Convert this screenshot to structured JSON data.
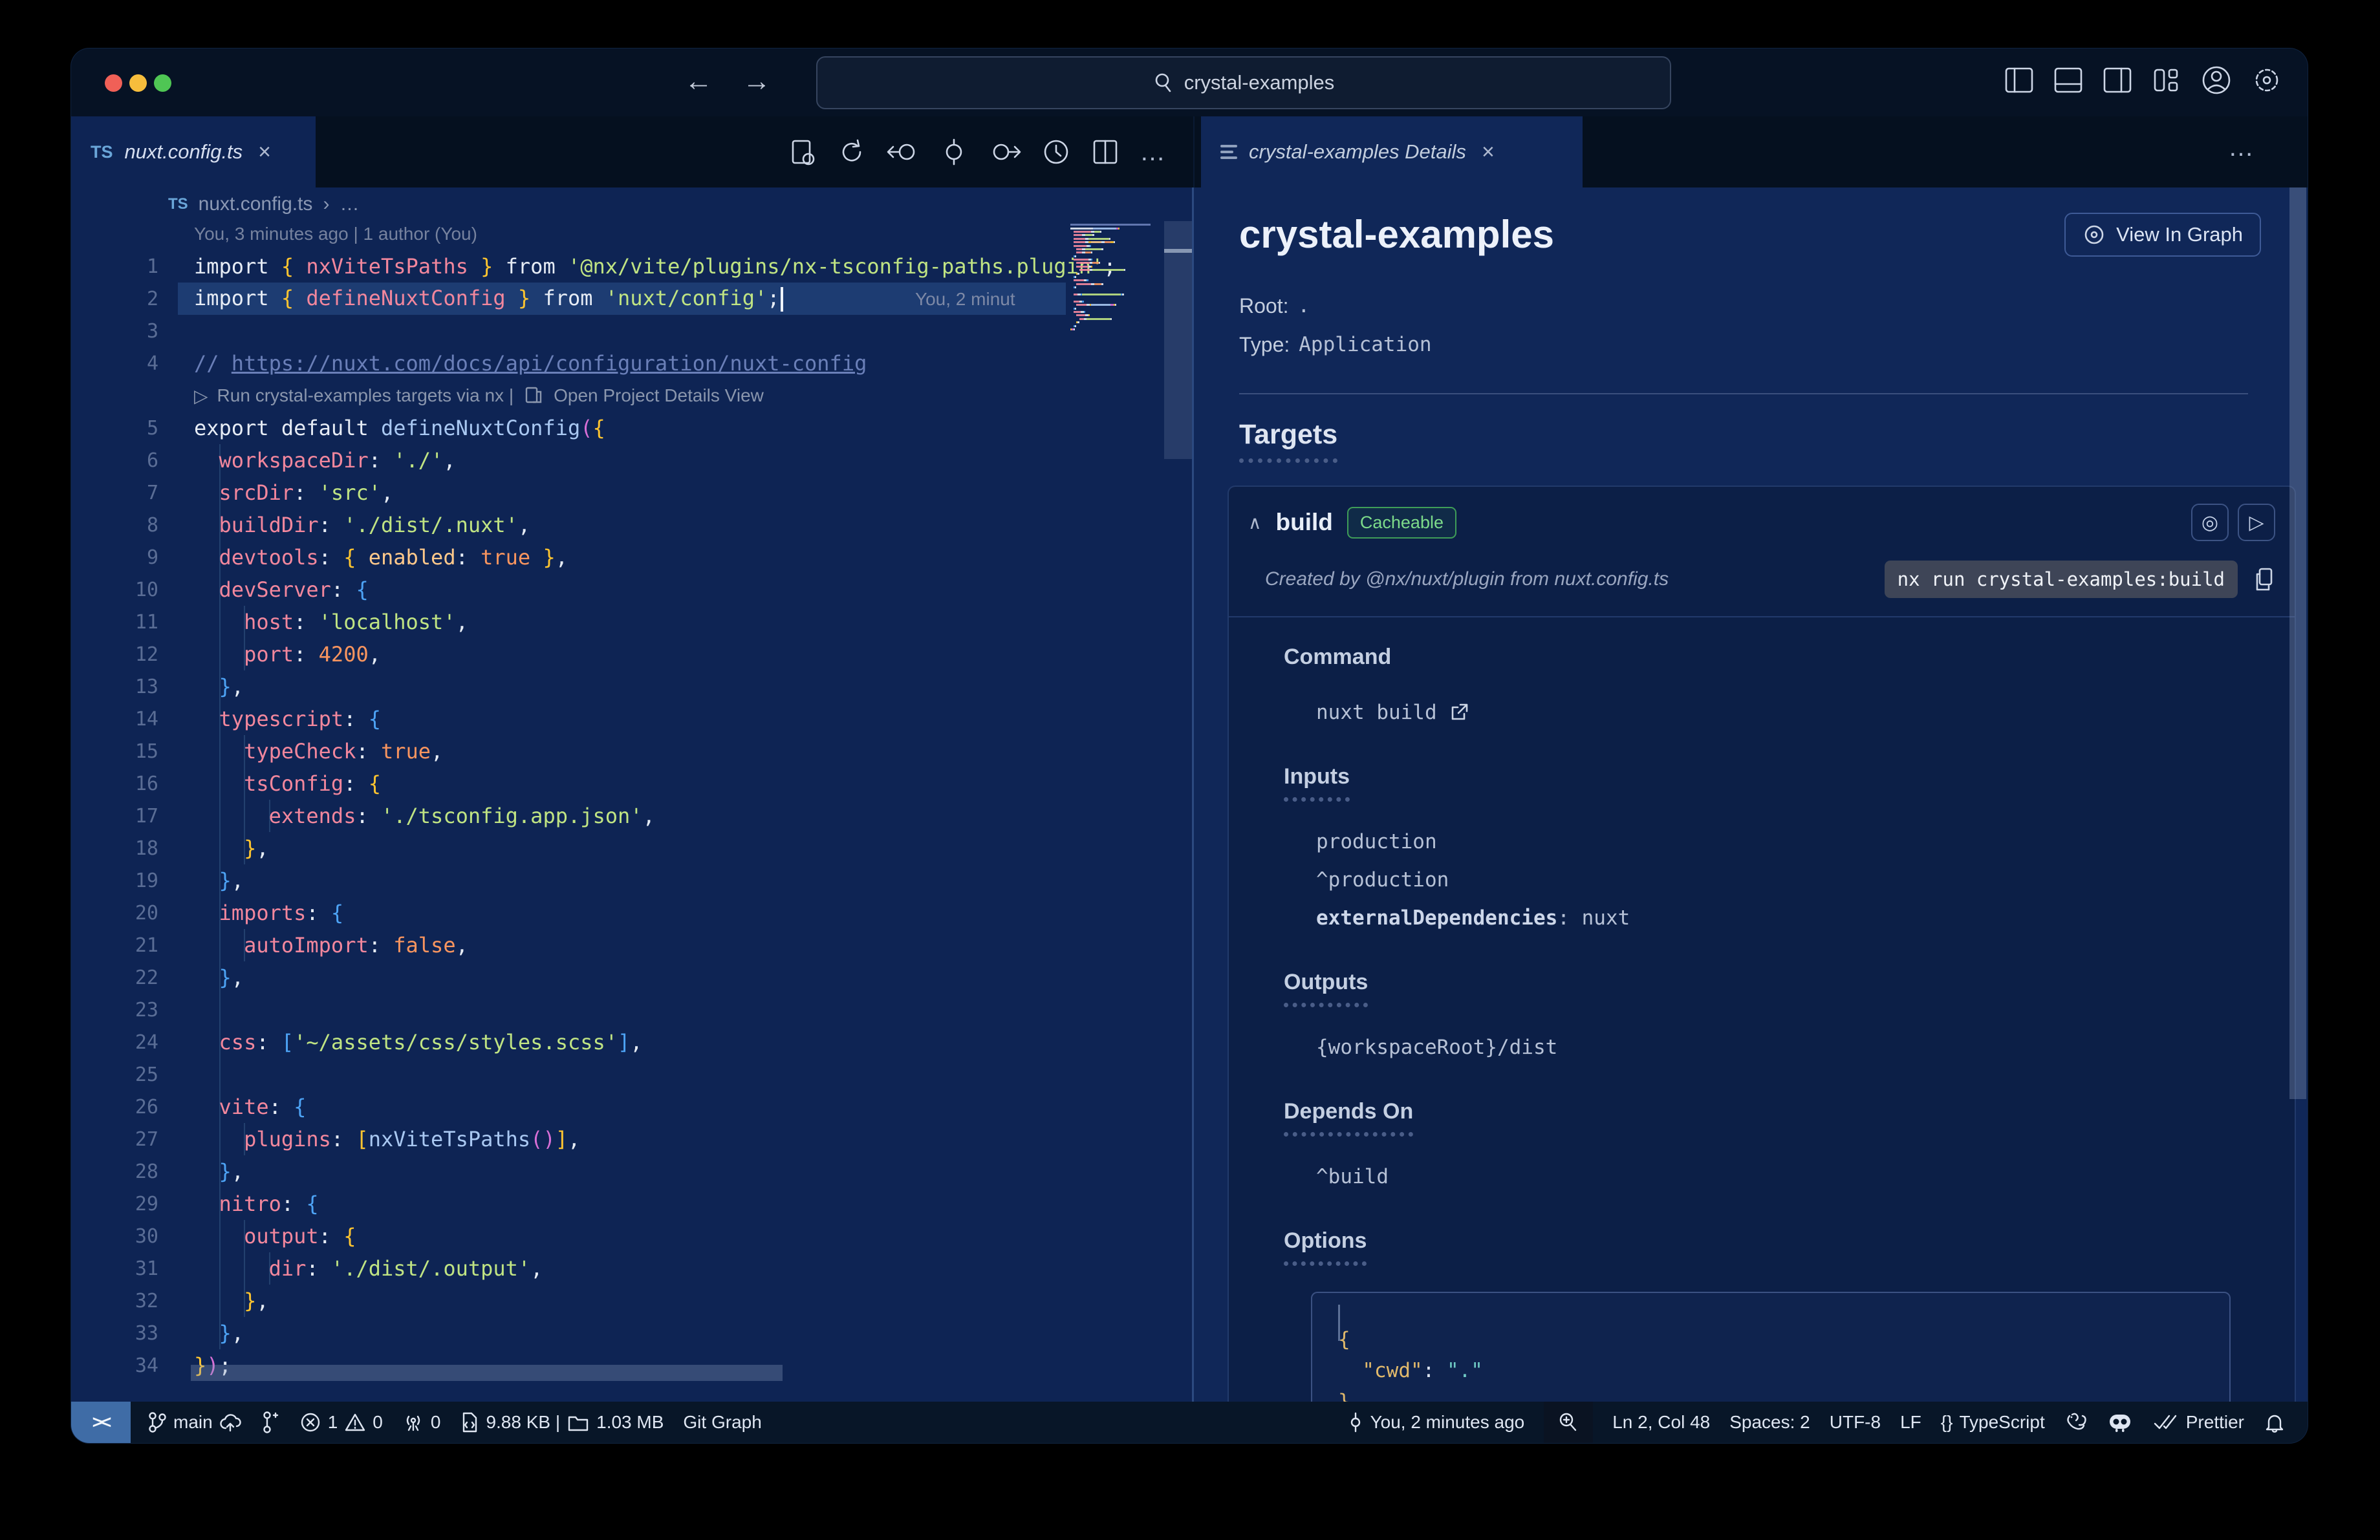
{
  "titlebar": {
    "search": "crystal-examples",
    "back": "←",
    "forward": "→"
  },
  "tabs": {
    "file": {
      "ts": "TS",
      "label": "nuxt.config.ts",
      "close": "×"
    },
    "details": {
      "label": "crystal-examples Details",
      "close": "×"
    },
    "more": "…"
  },
  "breadcrumb": {
    "ts": "TS",
    "file": "nuxt.config.ts",
    "sep": "›",
    "more": "…"
  },
  "editor": {
    "blame": "You, 3 minutes ago | 1 author (You)",
    "codelens": {
      "play": "▷",
      "run": "Run crystal-examples targets via nx  |",
      "open": "Open Project Details View"
    },
    "ghost": "You, 2 minut",
    "lines": [
      {
        "n": 1,
        "t": [
          [
            "import ",
            "pln"
          ],
          [
            "{ ",
            "bgold"
          ],
          [
            "nxViteTsPaths",
            "prop"
          ],
          [
            " }",
            "bgold"
          ],
          [
            " from ",
            "pln"
          ],
          [
            "'@nx/vite/plugins/nx-tsconfig-paths.plugin'",
            "str"
          ],
          [
            ";",
            "pln"
          ]
        ]
      },
      {
        "n": 2,
        "cur": true,
        "caret": true,
        "t": [
          [
            "import ",
            "pln"
          ],
          [
            "{ ",
            "bgold"
          ],
          [
            "defineNuxtConfig",
            "prop"
          ],
          [
            " }",
            "bgold"
          ],
          [
            " from ",
            "pln"
          ],
          [
            "'nuxt/config'",
            "str"
          ],
          [
            ";",
            "pln"
          ]
        ]
      },
      {
        "n": 3,
        "t": []
      },
      {
        "n": 4,
        "t": [
          [
            "// ",
            "cmt"
          ],
          [
            "https://nuxt.com/docs/api/configuration/nuxt-config",
            "lnk"
          ]
        ]
      },
      {
        "lens": true
      },
      {
        "n": 5,
        "t": [
          [
            "export default ",
            "pln"
          ],
          [
            "defineNuxtConfig",
            "call"
          ],
          [
            "(",
            "bmag"
          ],
          [
            "{",
            "bgold"
          ]
        ]
      },
      {
        "n": 6,
        "t": [
          [
            "  ",
            "pln"
          ],
          [
            "workspaceDir",
            "prop"
          ],
          [
            ": ",
            "pln"
          ],
          [
            "'./'",
            "str"
          ],
          [
            ",",
            "pln"
          ]
        ]
      },
      {
        "n": 7,
        "t": [
          [
            "  ",
            "pln"
          ],
          [
            "srcDir",
            "prop"
          ],
          [
            ": ",
            "pln"
          ],
          [
            "'src'",
            "str"
          ],
          [
            ",",
            "pln"
          ]
        ]
      },
      {
        "n": 8,
        "t": [
          [
            "  ",
            "pln"
          ],
          [
            "buildDir",
            "prop"
          ],
          [
            ": ",
            "pln"
          ],
          [
            "'./dist/.nuxt'",
            "str"
          ],
          [
            ",",
            "pln"
          ]
        ]
      },
      {
        "n": 9,
        "t": [
          [
            "  ",
            "pln"
          ],
          [
            "devtools",
            "prop"
          ],
          [
            ": ",
            "pln"
          ],
          [
            "{ ",
            "bgold"
          ],
          [
            "enabled",
            "peach"
          ],
          [
            ": ",
            "pln"
          ],
          [
            "true",
            "num"
          ],
          [
            " }",
            "bgold"
          ],
          [
            ",",
            "pln"
          ]
        ]
      },
      {
        "n": 10,
        "t": [
          [
            "  ",
            "pln"
          ],
          [
            "devServer",
            "prop"
          ],
          [
            ": ",
            "pln"
          ],
          [
            "{",
            "bblue"
          ]
        ]
      },
      {
        "n": 11,
        "t": [
          [
            "    ",
            "pln"
          ],
          [
            "host",
            "prop"
          ],
          [
            ": ",
            "pln"
          ],
          [
            "'localhost'",
            "str"
          ],
          [
            ",",
            "pln"
          ]
        ]
      },
      {
        "n": 12,
        "t": [
          [
            "    ",
            "pln"
          ],
          [
            "port",
            "prop"
          ],
          [
            ": ",
            "pln"
          ],
          [
            "4200",
            "num"
          ],
          [
            ",",
            "pln"
          ]
        ]
      },
      {
        "n": 13,
        "t": [
          [
            "  ",
            "pln"
          ],
          [
            "}",
            "bblue"
          ],
          [
            ",",
            "pln"
          ]
        ]
      },
      {
        "n": 14,
        "t": [
          [
            "  ",
            "pln"
          ],
          [
            "typescript",
            "prop"
          ],
          [
            ": ",
            "pln"
          ],
          [
            "{",
            "bblue"
          ]
        ]
      },
      {
        "n": 15,
        "t": [
          [
            "    ",
            "pln"
          ],
          [
            "typeCheck",
            "prop"
          ],
          [
            ": ",
            "pln"
          ],
          [
            "true",
            "num"
          ],
          [
            ",",
            "pln"
          ]
        ]
      },
      {
        "n": 16,
        "t": [
          [
            "    ",
            "pln"
          ],
          [
            "tsConfig",
            "prop"
          ],
          [
            ": ",
            "pln"
          ],
          [
            "{",
            "bgold"
          ]
        ]
      },
      {
        "n": 17,
        "t": [
          [
            "      ",
            "pln"
          ],
          [
            "extends",
            "prop"
          ],
          [
            ": ",
            "pln"
          ],
          [
            "'./tsconfig.app.json'",
            "str"
          ],
          [
            ",",
            "pln"
          ]
        ]
      },
      {
        "n": 18,
        "t": [
          [
            "    ",
            "pln"
          ],
          [
            "}",
            "bgold"
          ],
          [
            ",",
            "pln"
          ]
        ]
      },
      {
        "n": 19,
        "t": [
          [
            "  ",
            "pln"
          ],
          [
            "}",
            "bblue"
          ],
          [
            ",",
            "pln"
          ]
        ]
      },
      {
        "n": 20,
        "t": [
          [
            "  ",
            "pln"
          ],
          [
            "imports",
            "prop"
          ],
          [
            ": ",
            "pln"
          ],
          [
            "{",
            "bblue"
          ]
        ]
      },
      {
        "n": 21,
        "t": [
          [
            "    ",
            "pln"
          ],
          [
            "autoImport",
            "prop"
          ],
          [
            ": ",
            "pln"
          ],
          [
            "false",
            "num"
          ],
          [
            ",",
            "pln"
          ]
        ]
      },
      {
        "n": 22,
        "t": [
          [
            "  ",
            "pln"
          ],
          [
            "}",
            "bblue"
          ],
          [
            ",",
            "pln"
          ]
        ]
      },
      {
        "n": 23,
        "t": []
      },
      {
        "n": 24,
        "t": [
          [
            "  ",
            "pln"
          ],
          [
            "css",
            "prop"
          ],
          [
            ": ",
            "pln"
          ],
          [
            "[",
            "bblue"
          ],
          [
            "'~/assets/css/styles.scss'",
            "str"
          ],
          [
            "]",
            "bblue"
          ],
          [
            ",",
            "pln"
          ]
        ]
      },
      {
        "n": 25,
        "t": []
      },
      {
        "n": 26,
        "t": [
          [
            "  ",
            "pln"
          ],
          [
            "vite",
            "prop"
          ],
          [
            ": ",
            "pln"
          ],
          [
            "{",
            "bblue"
          ]
        ]
      },
      {
        "n": 27,
        "t": [
          [
            "    ",
            "pln"
          ],
          [
            "plugins",
            "prop"
          ],
          [
            ": ",
            "pln"
          ],
          [
            "[",
            "bgold"
          ],
          [
            "nxViteTsPaths",
            "call"
          ],
          [
            "(",
            "bmag"
          ],
          [
            ")",
            "bmag"
          ],
          [
            "]",
            "bgold"
          ],
          [
            ",",
            "pln"
          ]
        ]
      },
      {
        "n": 28,
        "t": [
          [
            "  ",
            "pln"
          ],
          [
            "}",
            "bblue"
          ],
          [
            ",",
            "pln"
          ]
        ]
      },
      {
        "n": 29,
        "t": [
          [
            "  ",
            "pln"
          ],
          [
            "nitro",
            "prop"
          ],
          [
            ": ",
            "pln"
          ],
          [
            "{",
            "bblue"
          ]
        ]
      },
      {
        "n": 30,
        "t": [
          [
            "    ",
            "pln"
          ],
          [
            "output",
            "prop"
          ],
          [
            ": ",
            "pln"
          ],
          [
            "{",
            "bgold"
          ]
        ]
      },
      {
        "n": 31,
        "t": [
          [
            "      ",
            "pln"
          ],
          [
            "dir",
            "prop"
          ],
          [
            ": ",
            "pln"
          ],
          [
            "'./dist/.output'",
            "str"
          ],
          [
            ",",
            "pln"
          ]
        ]
      },
      {
        "n": 32,
        "t": [
          [
            "    ",
            "pln"
          ],
          [
            "}",
            "bgold"
          ],
          [
            ",",
            "pln"
          ]
        ]
      },
      {
        "n": 33,
        "t": [
          [
            "  ",
            "pln"
          ],
          [
            "}",
            "bblue"
          ],
          [
            ",",
            "pln"
          ]
        ]
      },
      {
        "n": 34,
        "t": [
          [
            "}",
            "bgold"
          ],
          [
            ")",
            "bmag"
          ],
          [
            ";",
            "pln"
          ]
        ]
      }
    ]
  },
  "panel": {
    "title": "crystal-examples",
    "view_in_graph": "View In Graph",
    "root_label": "Root:",
    "root_value": ".",
    "type_label": "Type:",
    "type_value": "Application",
    "targets_heading": "Targets",
    "build": {
      "chevron": "∧",
      "name": "build",
      "badge": "Cacheable",
      "created_by": "Created by @nx/nuxt/plugin from nuxt.config.ts",
      "run_command": "nx run crystal-examples:build",
      "eye": "◎",
      "play": "▷",
      "command_heading": "Command",
      "command_value": "nuxt build",
      "inputs_heading": "Inputs",
      "inputs": [
        "production",
        "^production"
      ],
      "inputs_kv": {
        "key": "externalDependencies",
        "rest": ": nuxt"
      },
      "outputs_heading": "Outputs",
      "outputs_value": "{workspaceRoot}/dist",
      "depends_heading": "Depends On",
      "depends_value": "^build",
      "options_heading": "Options",
      "options_json": {
        "open": "{",
        "key": "\"cwd\"",
        "colon": ": ",
        "value": "\".\"",
        "close": "}"
      }
    }
  },
  "statusbar": {
    "left": {
      "remote": "><",
      "branch": "main",
      "errors": "1",
      "warnings": "0",
      "ports": "0",
      "size": "9.88 KB |",
      "mem": "1.03 MB",
      "gitgraph": "Git Graph"
    },
    "right": {
      "blame": "You, 2 minutes ago",
      "cursor": "Ln 2, Col 48",
      "spaces": "Spaces: 2",
      "encoding": "UTF-8",
      "eol": "LF",
      "lang_icon": "{}",
      "lang": "TypeScript",
      "prettier": "Prettier"
    }
  }
}
